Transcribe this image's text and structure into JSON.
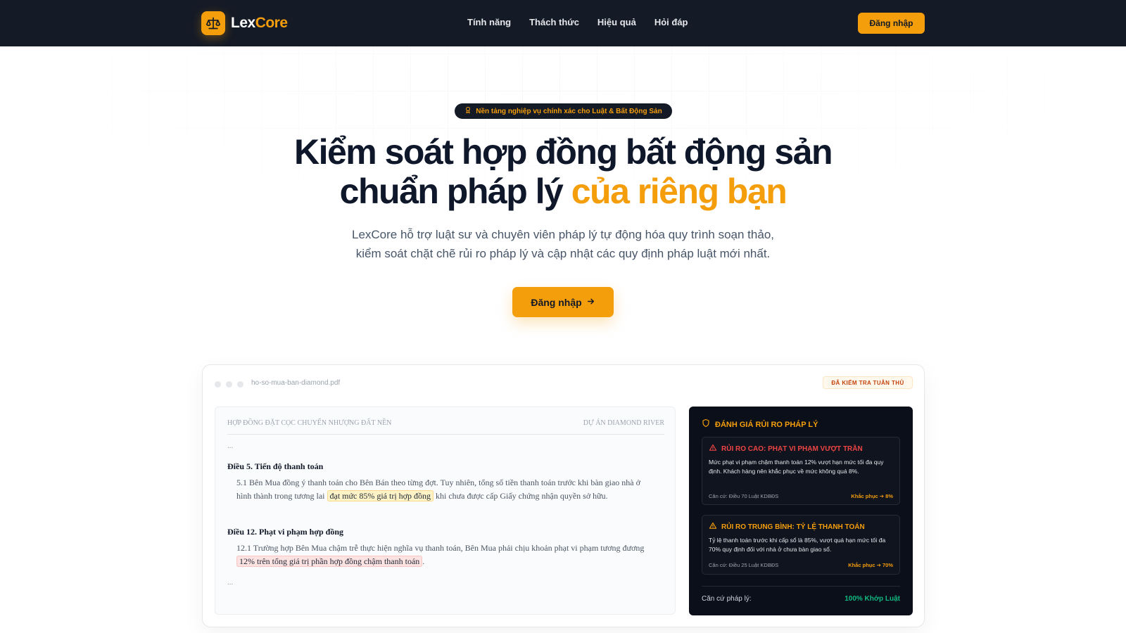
{
  "brand": {
    "name_part1": "Lex",
    "name_part2": "Core",
    "accent_color": "#f59e0b",
    "nav_bg": "#141a26",
    "logo_icon": "scale-icon"
  },
  "nav": {
    "links": [
      {
        "label": "Tính năng"
      },
      {
        "label": "Thách thức"
      },
      {
        "label": "Hiệu quả"
      },
      {
        "label": "Hỏi đáp"
      }
    ],
    "login_label": "Đăng nhập"
  },
  "hero": {
    "badge_icon": "award-icon",
    "badge": "Nền tảng nghiệp vụ chính xác cho Luật & Bất Động Sản",
    "title_line1": "Kiểm soát hợp đồng bất động sản",
    "title_line2_plain": "chuẩn pháp lý",
    "title_line2_accent": "của riêng bạn",
    "subtitle_line1": "LexCore hỗ trợ luật sư và chuyên viên pháp lý tự động hóa quy trình soạn thảo,",
    "subtitle_line2": "kiểm soát chặt chẽ rủi ro pháp lý và cập nhật các quy định pháp luật mới nhất.",
    "cta_label": "Đăng nhập",
    "cta_icon": "arrow-right-icon"
  },
  "preview": {
    "filename": "ho-so-mua-ban-diamond.pdf",
    "status_badge": "ĐÃ KIỂM TRA TUÂN THỦ",
    "document": {
      "header_left": "HỢP ĐỒNG ĐẶT CỌC CHUYỂN NHƯỢNG ĐẤT NỀN",
      "header_right": "DỰ ÁN DIAMOND RIVER",
      "ellipsis": "...",
      "article5": {
        "title": "Điều 5. Tiến độ thanh toán",
        "text_before": "5.1 Bên Mua đồng ý thanh toán cho Bên Bán theo từng đợt. Tuy nhiên, tổng số tiền thanh toán trước khi bàn giao nhà ở hình thành trong tương lai",
        "highlight": "đạt mức 85% giá trị hợp đồng",
        "text_after": "khi chưa được cấp Giấy chứng nhận quyền sở hữu."
      },
      "article12": {
        "title": "Điều 12. Phạt vi phạm hợp đồng",
        "text_before": "12.1 Trường hợp Bên Mua chậm trễ thực hiện nghĩa vụ thanh toán, Bên Mua phải chịu khoản phạt vi phạm tương đương",
        "highlight": "12% trên tổng giá trị phần hợp đồng chậm thanh toán",
        "text_after": "."
      }
    },
    "risk": {
      "heading": "ĐÁNH GIÁ RỦI RO PHÁP LÝ",
      "heading_icon": "shield-icon",
      "items": [
        {
          "title": "RỦI RO CAO: PHẠT VI PHẠM VƯỢT TRẦN",
          "color": "#ef4444",
          "icon": "warning-icon",
          "body": "Mức phạt vi phạm chậm thanh toán 12% vượt hạn mức tối đa quy định. Khách hàng nên khắc phục về mức không quá 8%.",
          "basis": "Căn cứ: Điều 70 Luật KDBĐS",
          "fix": "Khắc phục ➔ 8%"
        },
        {
          "title": "RỦI RO TRUNG BÌNH: TỶ LỆ THANH TOÁN",
          "color": "#f59e0b",
          "icon": "warning-icon",
          "body": "Tỷ lệ thanh toán trước khi cấp sổ là 85%, vượt quá hạn mức tối đa 70% quy định đối với nhà ở chưa bàn giao sổ.",
          "basis": "Căn cứ: Điều 25 Luật KDBĐS",
          "fix": "Khắc phục ➔ 70%"
        }
      ],
      "footer_label": "Căn cứ pháp lý:",
      "footer_value": "100% Khớp Luật"
    }
  }
}
